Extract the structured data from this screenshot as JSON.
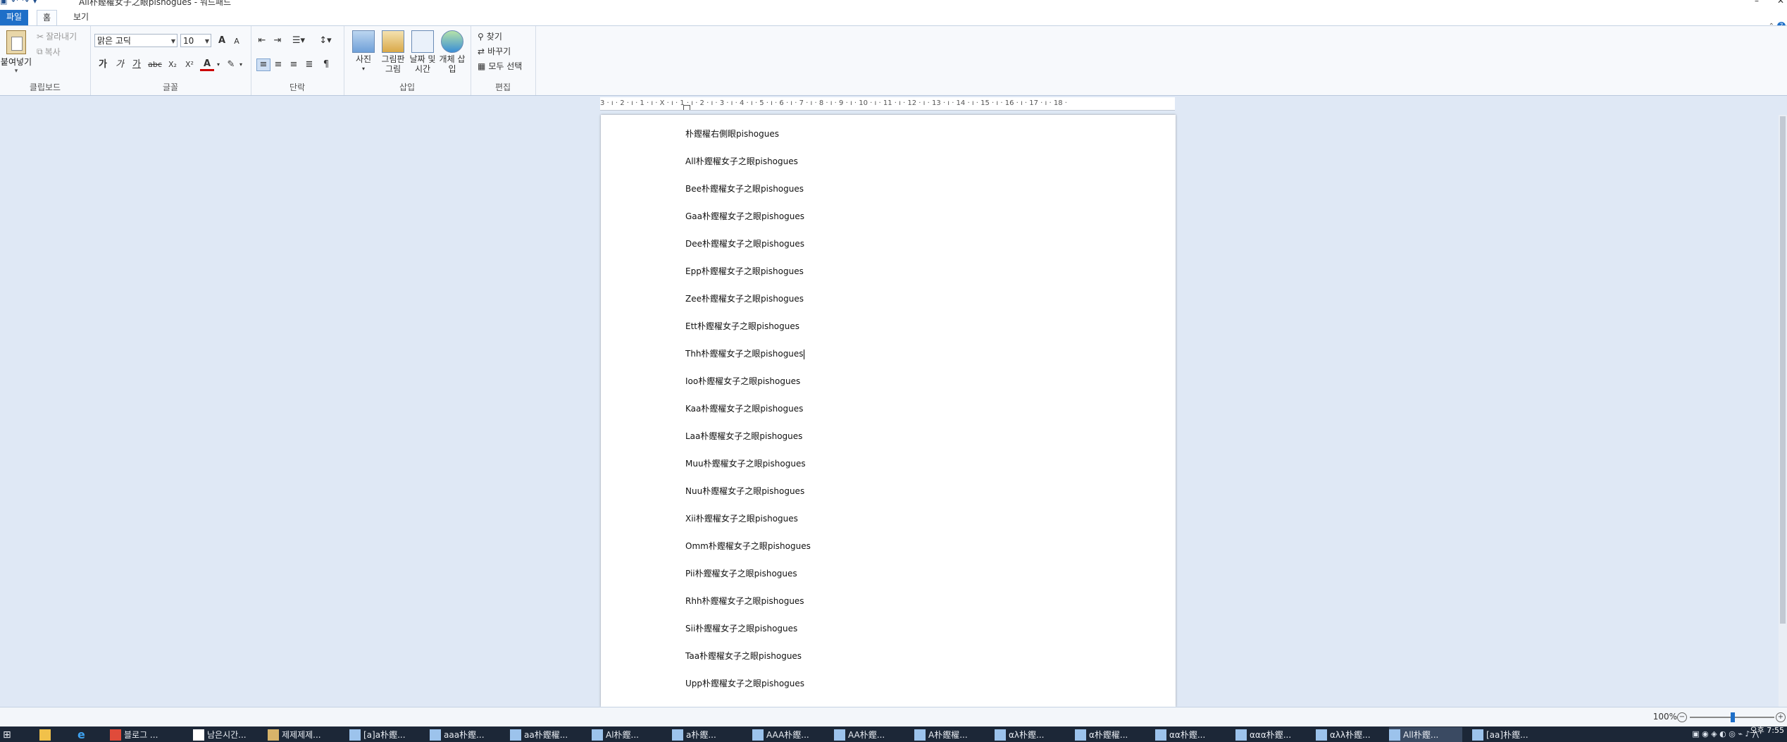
{
  "window": {
    "title": "All朴鏗櫂女子之眼pishogues - 워드패드",
    "min_label": "–",
    "close_label": "✕"
  },
  "tabs": [
    {
      "label": "파일"
    },
    {
      "label": "홈"
    },
    {
      "label": "보기"
    }
  ],
  "ribbon": {
    "clipboard": {
      "label": "클립보드",
      "paste": "붙여넣기",
      "cut": "잘라내기",
      "copy": "복사"
    },
    "font": {
      "label": "글꼴",
      "family": "맑은 고딕",
      "size": "10",
      "grow": "A",
      "shrink": "A",
      "bold": "가",
      "italic": "가",
      "underline": "가",
      "strike": "abc",
      "sub": "X₂",
      "sup": "X²",
      "color": "A"
    },
    "paragraph": {
      "label": "단락"
    },
    "insert": {
      "label": "삽입",
      "picture": "사진",
      "paint": "그림판 그림",
      "datetime": "날짜 및 시간",
      "object": "개체 삽입"
    },
    "editing": {
      "label": "편집",
      "find": "찾기",
      "replace": "바꾸기",
      "select_all": "모두 선택"
    }
  },
  "ruler": {
    "text": "3 · ı · 2 · ı · 1 · ı · X · ı · 1 · ı · 2 · ı · 3 · ı · 4 · ı · 5 · ı · 6 · ı · 7 · ı · 8 · ı · 9 · ı · 10 · ı · 11 · ı · 12 · ı · 13 · ı · 14 · ı · 15 · ı · 16 · ı · 17 · ı · 18 ·"
  },
  "document": {
    "lines": [
      "朴鏗櫂右側眼pishogues",
      "All朴鏗櫂女子之眼pishogues",
      "Bee朴鏗櫂女子之眼pishogues",
      "Gaa朴鏗櫂女子之眼pishogues",
      "Dee朴鏗櫂女子之眼pishogues",
      "Epp朴鏗櫂女子之眼pishogues",
      "Zee朴鏗櫂女子之眼pishogues",
      "Ett朴鏗櫂女子之眼pishogues",
      "Thh朴鏗櫂女子之眼pishogues",
      "Ioo朴鏗櫂女子之眼pishogues",
      "Kaa朴鏗櫂女子之眼pishogues",
      "Laa朴鏗櫂女子之眼pishogues",
      "Muu朴鏗櫂女子之眼pishogues",
      "Nuu朴鏗櫂女子之眼pishogues",
      "Xii朴鏗櫂女子之眼pishogues",
      "Omm朴鏗櫂女子之眼pishogues",
      "Pii朴鏗櫂女子之眼pishogues",
      "Rhh朴鏗櫂女子之眼pishogues",
      "Sii朴鏗櫂女子之眼pishogues",
      "Taa朴鏗櫂女子之眼pishogues",
      "Upp朴鏗櫂女子之眼pishogues"
    ],
    "cursor_line": 8
  },
  "status": {
    "zoom": "100%"
  },
  "taskbar": {
    "items": [
      {
        "label": "블로그 ..."
      },
      {
        "label": "남은시간..."
      },
      {
        "label": "제제제제..."
      },
      {
        "label": "[a]a朴鏗..."
      },
      {
        "label": "aaa朴鏗..."
      },
      {
        "label": "aa朴鏗櫂..."
      },
      {
        "label": "Al朴鏗..."
      },
      {
        "label": "a朴鏗..."
      },
      {
        "label": "AAA朴鏗..."
      },
      {
        "label": "AA朴鏗..."
      },
      {
        "label": "A朴鏗櫂..."
      },
      {
        "label": "αλ朴鏗..."
      },
      {
        "label": "α朴鏗櫂..."
      },
      {
        "label": "αα朴鏗..."
      },
      {
        "label": "ααα朴鏗..."
      },
      {
        "label": "αλλ朴鏗..."
      },
      {
        "label": "All朴鏗..."
      },
      {
        "label": "[aa]朴鏗..."
      }
    ],
    "clock": "오후 7:55",
    "colors": {
      "bar": "#1c2737",
      "accent": "#1e6fc8"
    }
  }
}
